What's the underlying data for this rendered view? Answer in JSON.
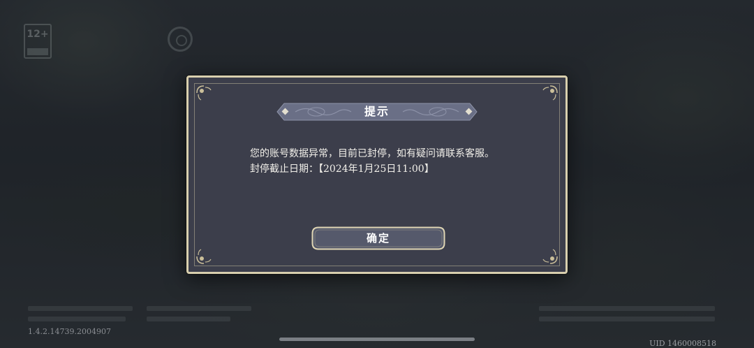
{
  "background": {
    "age_rating": "12+",
    "version": "1.4.2.14739.2004907",
    "uid": "UID 1460008518"
  },
  "dialog": {
    "title": "提示",
    "message_line1": "您的账号数据异常，目前已封停，如有疑问请联系客服。",
    "message_line2": "封停截止日期：【2024年1月25日11:00】",
    "confirm_label": "确定"
  },
  "colors": {
    "dialog_bg": "#3c3e4b",
    "dialog_border": "#d8cfae",
    "banner_bg": "#6a6f86",
    "button_bg": "#55596b"
  }
}
